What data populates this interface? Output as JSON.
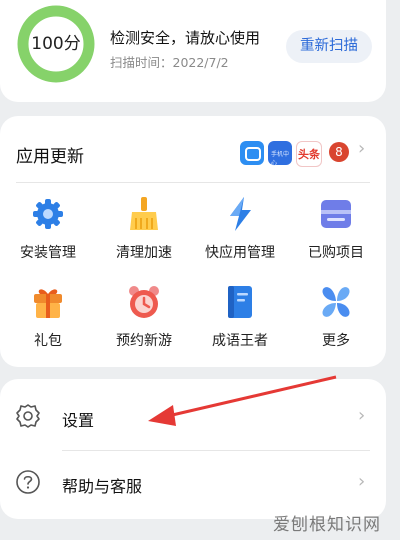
{
  "scan": {
    "score": "100分",
    "title": "检测安全，请放心使用",
    "time": "扫描时间：2022/7/2",
    "rescan_label": "重新扫描",
    "ring_color": "#86d26a"
  },
  "app_update": {
    "title": "应用更新",
    "mini_icons": [
      "",
      "手机中心",
      "头条"
    ],
    "badge": "8",
    "items": [
      {
        "label": "安装管理",
        "icon": "gear-icon"
      },
      {
        "label": "清理加速",
        "icon": "broom-icon"
      },
      {
        "label": "快应用管理",
        "icon": "lightning-icon"
      },
      {
        "label": "已购项目",
        "icon": "purchased-icon"
      },
      {
        "label": "礼包",
        "icon": "gift-icon"
      },
      {
        "label": "预约新游",
        "icon": "alarm-clock-icon"
      },
      {
        "label": "成语王者",
        "icon": "book-icon"
      },
      {
        "label": "更多",
        "icon": "more-icon"
      }
    ]
  },
  "settings": {
    "settings_label": "设置",
    "help_label": "帮助与客服"
  },
  "watermark": "爱刨根知识网",
  "colors": {
    "accent": "#2c6ad8",
    "arrow": "#e53935",
    "badge": "#d9452f"
  }
}
